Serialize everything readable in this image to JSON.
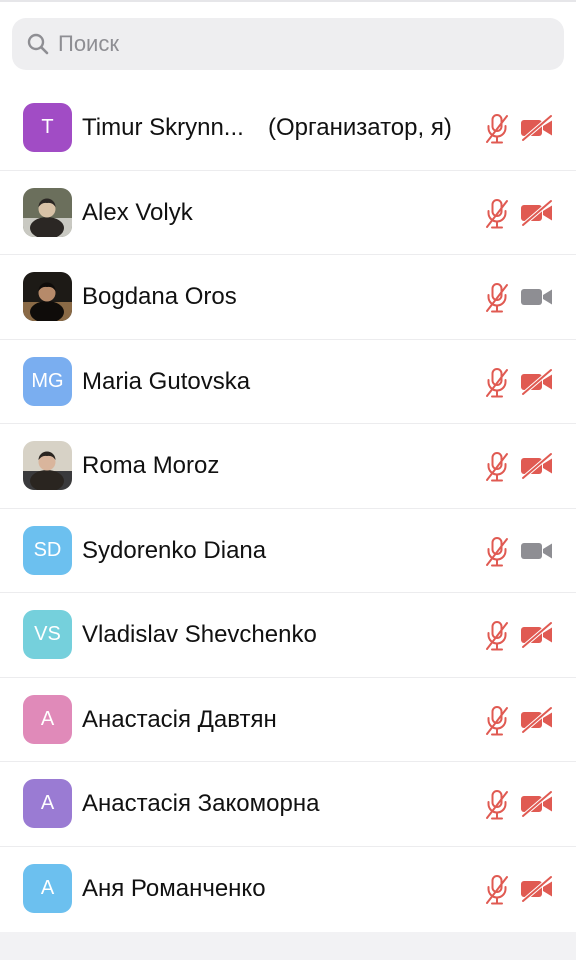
{
  "search": {
    "placeholder": "Поиск"
  },
  "colors": {
    "muted_red": "#e05a52",
    "camera_on_gray": "#8e8e93",
    "search_bg": "#eeeef0"
  },
  "participants": [
    {
      "name": "Timur Skrynn...",
      "role": "(Организатор, я)",
      "initials": "T",
      "avatar_color": "#a14cc5",
      "mic": "muted",
      "camera": "off"
    },
    {
      "name": "Alex Volyk",
      "role": "",
      "initials": "",
      "avatar": "photo",
      "mic": "muted",
      "camera": "off"
    },
    {
      "name": "Bogdana Oros",
      "role": "",
      "initials": "",
      "avatar": "photo",
      "mic": "muted",
      "camera": "on"
    },
    {
      "name": "Maria Gutovska",
      "role": "",
      "initials": "MG",
      "avatar_color": "#7aaef0",
      "mic": "muted",
      "camera": "off"
    },
    {
      "name": "Roma Moroz",
      "role": "",
      "initials": "",
      "avatar": "photo",
      "mic": "muted",
      "camera": "off"
    },
    {
      "name": "Sydorenko Diana",
      "role": "",
      "initials": "SD",
      "avatar_color": "#6cc0ef",
      "mic": "muted",
      "camera": "on"
    },
    {
      "name": "Vladislav Shevchenko",
      "role": "",
      "initials": "VS",
      "avatar_color": "#75d0dc",
      "mic": "muted",
      "camera": "off"
    },
    {
      "name": "Анастасія Давтян",
      "role": "",
      "initials": "A",
      "avatar_color": "#e08ab9",
      "mic": "muted",
      "camera": "off"
    },
    {
      "name": "Анастасія Закоморна",
      "role": "",
      "initials": "A",
      "avatar_color": "#9a7bd3",
      "mic": "muted",
      "camera": "off"
    },
    {
      "name": "Аня Романченко",
      "role": "",
      "initials": "A",
      "avatar_color": "#6cc0ef",
      "mic": "muted",
      "camera": "off"
    }
  ]
}
